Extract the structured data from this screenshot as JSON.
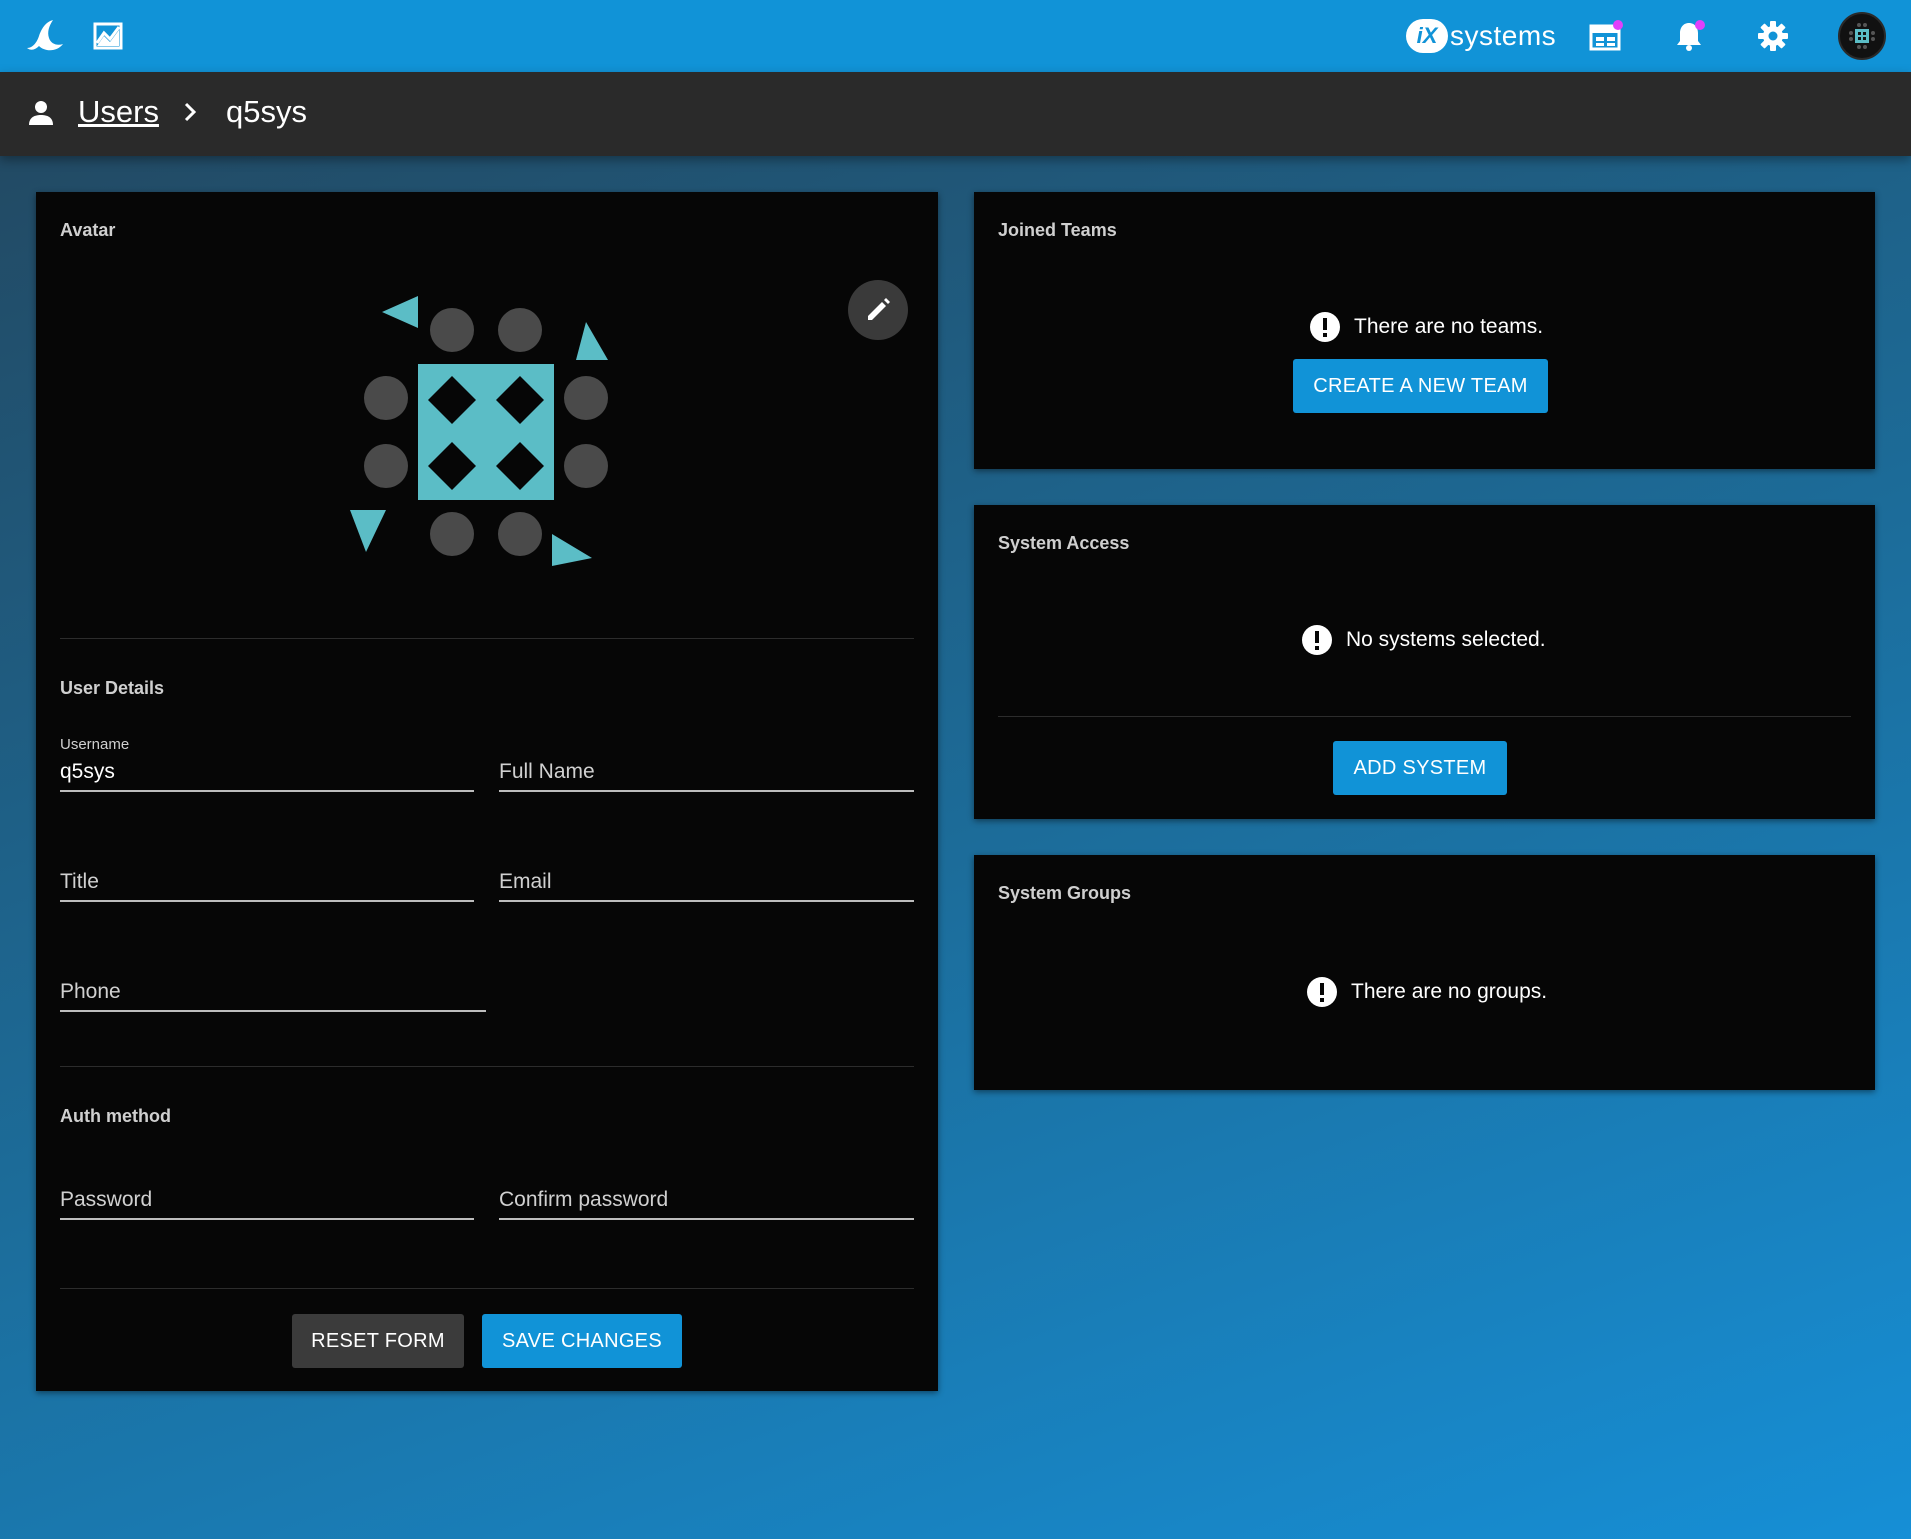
{
  "topbar": {
    "logo_icon": "truecommand-logo-icon",
    "reports_icon": "reports-icon",
    "brand_mark": "iX",
    "brand_text": "systems",
    "calendar_icon": "calendar-icon",
    "bell_icon": "bell-icon",
    "gear_icon": "gear-icon",
    "notification_color": "#e040fb"
  },
  "breadcrumb": {
    "parent": "Users",
    "current": "q5sys"
  },
  "avatar_card": {
    "title": "Avatar",
    "user_details_title": "User Details",
    "username_label": "Username",
    "username_value": "q5sys",
    "full_name_placeholder": "Full Name",
    "title_placeholder": "Title",
    "email_placeholder": "Email",
    "phone_placeholder": "Phone",
    "auth_title": "Auth method",
    "password_placeholder": "Password",
    "confirm_password_placeholder": "Confirm password",
    "reset_label": "RESET FORM",
    "save_label": "SAVE CHANGES",
    "avatar_color": "#5bbdc6"
  },
  "teams_card": {
    "title": "Joined Teams",
    "empty_text": "There are no teams.",
    "button_label": "CREATE A NEW TEAM"
  },
  "system_access_card": {
    "title": "System Access",
    "empty_text": "No systems selected.",
    "button_label": "ADD SYSTEM"
  },
  "system_groups_card": {
    "title": "System Groups",
    "empty_text": "There are no groups."
  },
  "colors": {
    "topbar": "#1193d7",
    "card": "#060606",
    "primary_button": "#1193d7",
    "secondary_button": "#3b3b3b"
  }
}
